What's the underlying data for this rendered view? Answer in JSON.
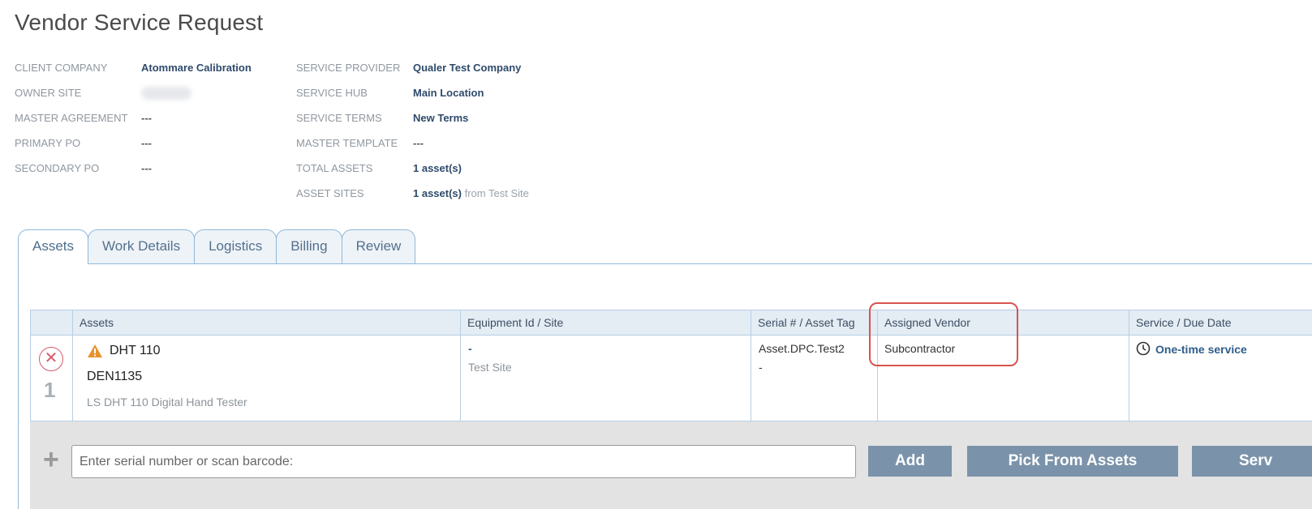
{
  "page": {
    "title": "Vendor Service Request"
  },
  "info_left": [
    {
      "label": "CLIENT COMPANY",
      "value": "Atommare Calibration"
    },
    {
      "label": "OWNER SITE",
      "value": ""
    },
    {
      "label": "MASTER AGREEMENT",
      "value": "---"
    },
    {
      "label": "PRIMARY PO",
      "value": "---"
    },
    {
      "label": "SECONDARY PO",
      "value": "---"
    }
  ],
  "info_right": [
    {
      "label": "SERVICE PROVIDER",
      "value": "Qualer Test Company"
    },
    {
      "label": "SERVICE HUB",
      "value": "Main Location"
    },
    {
      "label": "SERVICE TERMS",
      "value": "New Terms"
    },
    {
      "label": "MASTER TEMPLATE",
      "value": "---"
    },
    {
      "label": "TOTAL ASSETS",
      "value": "1 asset(s)"
    },
    {
      "label": "ASSET SITES",
      "value": "1 asset(s)",
      "suffix": "from Test Site"
    }
  ],
  "tabs": [
    {
      "label": "Assets",
      "active": true
    },
    {
      "label": "Work Details"
    },
    {
      "label": "Logistics"
    },
    {
      "label": "Billing"
    },
    {
      "label": "Review"
    }
  ],
  "grid": {
    "columns": [
      "Assets",
      "Equipment Id / Site",
      "Serial # / Asset Tag",
      "Assigned Vendor",
      "Service / Due Date"
    ],
    "rows": [
      {
        "row_number": "1",
        "remove_icon": "close-circle-icon",
        "asset_name": "DHT 110",
        "asset_warning_icon": "warning-triangle-icon",
        "asset_id": "DEN1135",
        "asset_description": "LS DHT 110 Digital Hand Tester",
        "equipment_id": "-",
        "site": "Test Site",
        "serial": "Asset.DPC.Test2",
        "asset_tag": "-",
        "assigned_vendor": "Subcontractor",
        "service_icon": "clock-icon",
        "service": "One-time service"
      }
    ]
  },
  "add_bar": {
    "plus_icon": "plus-icon",
    "input_placeholder": "Enter serial number or scan barcode:",
    "add_label": "Add",
    "pick_label": "Pick From Assets",
    "service_label": "Serv"
  },
  "colors": {
    "accent": "#2f4a6b",
    "highlight": "#d9534f",
    "button": "#7b93aa"
  }
}
